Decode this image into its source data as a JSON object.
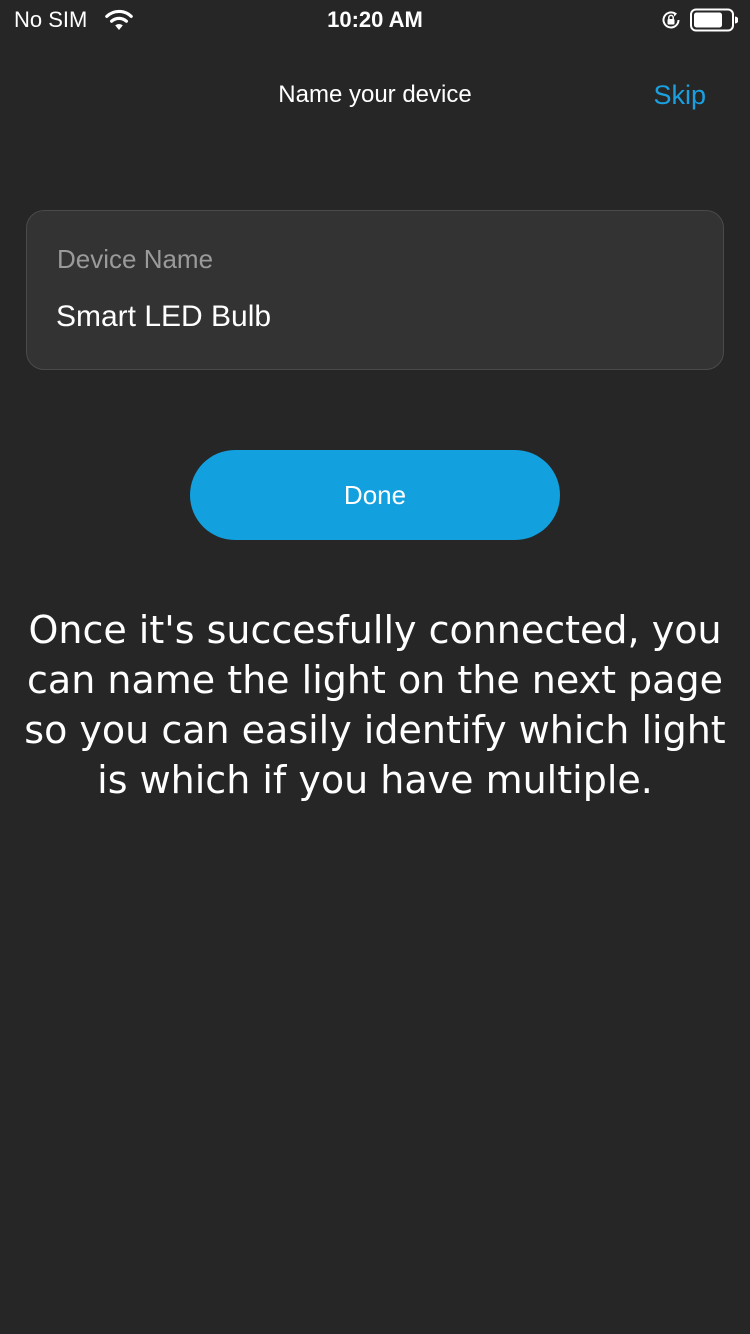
{
  "status_bar": {
    "carrier": "No SIM",
    "time": "10:20 AM",
    "icons": [
      "wifi-icon",
      "orientation-lock-icon",
      "battery-icon"
    ]
  },
  "nav": {
    "title": "Name your device",
    "skip_label": "Skip"
  },
  "form": {
    "field_label": "Device Name",
    "field_value": "Smart LED Bulb",
    "field_placeholder": "Device Name"
  },
  "actions": {
    "done_label": "Done"
  },
  "info": {
    "text": "Once it's succesfully connected, you can name the light on the next page so you can easily identify which light is which if you have multiple."
  },
  "colors": {
    "background": "#262626",
    "accent": "#12a0de",
    "link": "#1aa0e0",
    "card": "#333333"
  }
}
